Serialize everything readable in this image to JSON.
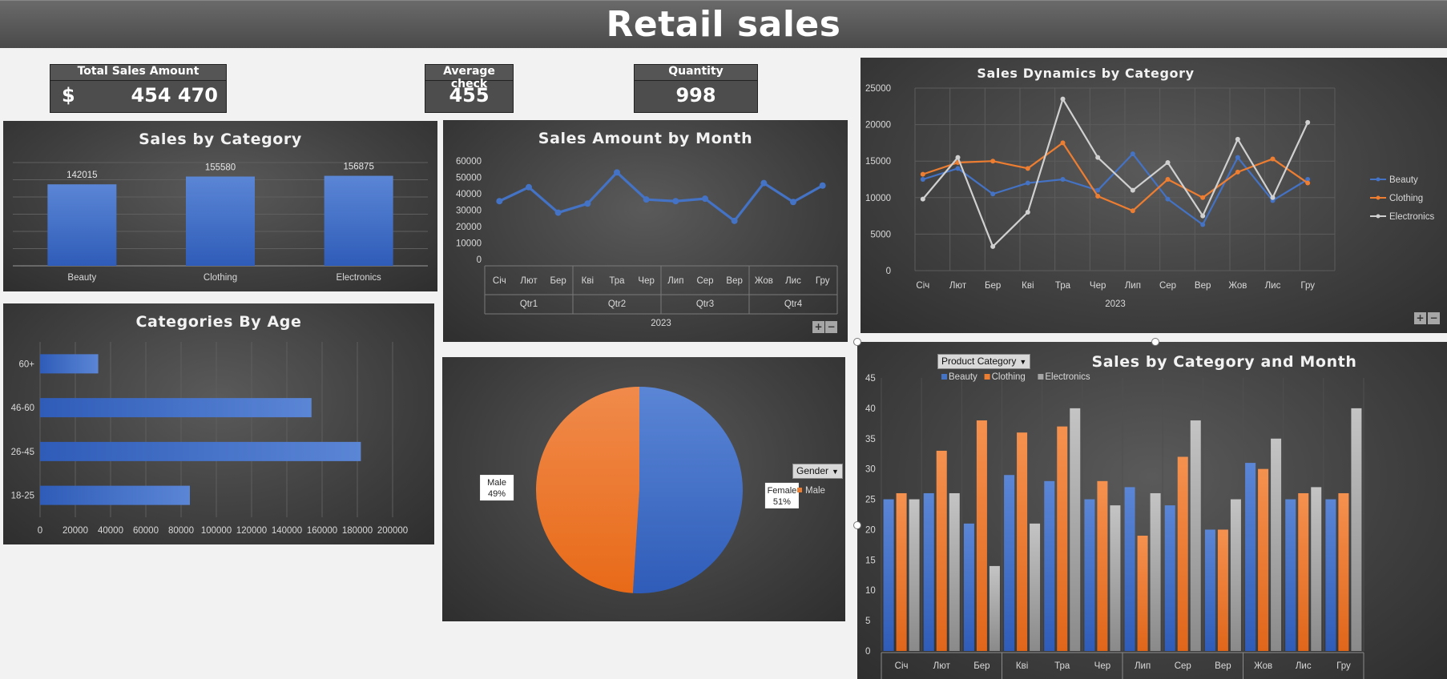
{
  "title": "Retail sales",
  "kpis": {
    "total": {
      "label": "Total Sales Amount",
      "currency": "$",
      "value": "454 470"
    },
    "avg": {
      "label": "Average check",
      "value": "455"
    },
    "qty": {
      "label": "Quantity",
      "value": "998"
    }
  },
  "colors": {
    "blue": "#4472c4",
    "orange": "#ed7d31",
    "gray": "#a5a5a5"
  },
  "chart_data": [
    {
      "id": "cat",
      "type": "bar",
      "title": "Sales by Category",
      "categories": [
        "Beauty",
        "Clothing",
        "Electronics"
      ],
      "values": [
        142015,
        155580,
        156875
      ],
      "ylim": [
        0,
        180000
      ],
      "grid": true
    },
    {
      "id": "month",
      "type": "line",
      "title": "Sales Amount by Month",
      "categories": [
        "Січ",
        "Лют",
        "Бер",
        "Кві",
        "Тра",
        "Чер",
        "Лип",
        "Сер",
        "Вер",
        "Жов",
        "Лис",
        "Гру"
      ],
      "quarters": [
        "Qtr1",
        "Qtr2",
        "Qtr3",
        "Qtr4"
      ],
      "year": "2023",
      "values": [
        35500,
        44000,
        28500,
        34000,
        53000,
        36500,
        35500,
        37000,
        23500,
        46500,
        35000,
        45000
      ],
      "yticks": [
        "0",
        "10000",
        "20000",
        "30000",
        "40000",
        "50000",
        "60000"
      ],
      "ylim": [
        0,
        60000
      ]
    },
    {
      "id": "dyn",
      "type": "line",
      "title": "Sales Dynamics by Category",
      "categories": [
        "Січ",
        "Лют",
        "Бер",
        "Кві",
        "Тра",
        "Чер",
        "Лип",
        "Сер",
        "Вер",
        "Жов",
        "Лис",
        "Гру"
      ],
      "year": "2023",
      "yticks": [
        "0",
        "5000",
        "10000",
        "15000",
        "20000",
        "25000"
      ],
      "ylim": [
        0,
        25000
      ],
      "legend": "right",
      "series": [
        {
          "name": "Beauty",
          "values": [
            12500,
            14000,
            10500,
            12000,
            12500,
            11000,
            16000,
            9800,
            6300,
            15500,
            9600,
            12500
          ]
        },
        {
          "name": "Clothing",
          "values": [
            13200,
            14800,
            15000,
            14000,
            17500,
            10200,
            8200,
            12500,
            10000,
            13500,
            15300,
            12000
          ]
        },
        {
          "name": "Electronics",
          "values": [
            9800,
            15500,
            3300,
            8000,
            23500,
            15500,
            11000,
            14800,
            7500,
            18000,
            10000,
            20300
          ]
        }
      ]
    },
    {
      "id": "age",
      "type": "bar",
      "orientation": "horizontal",
      "title": "Categories By Age",
      "categories": [
        "60+",
        "46-60",
        "26-45",
        "18-25"
      ],
      "values": [
        33000,
        154000,
        182000,
        85000
      ],
      "xticks": [
        "0",
        "20000",
        "40000",
        "60000",
        "80000",
        "100000",
        "120000",
        "140000",
        "160000",
        "180000",
        "200000"
      ],
      "xlim": [
        0,
        210000
      ]
    },
    {
      "id": "gender",
      "type": "pie",
      "filter": "Gender",
      "legend": "right",
      "series": [
        {
          "name": "Female",
          "label": "Female\n51%",
          "value": 51
        },
        {
          "name": "Male",
          "label": "Male\n49%",
          "value": 49
        }
      ]
    },
    {
      "id": "catmonth",
      "type": "bar",
      "title": "Sales by Category and Month",
      "filter": "Product Category",
      "categories": [
        "Січ",
        "Лют",
        "Бер",
        "Кві",
        "Тра",
        "Чер",
        "Лип",
        "Сер",
        "Вер",
        "Жов",
        "Лис",
        "Гру"
      ],
      "yticks": [
        "0",
        "5",
        "10",
        "15",
        "20",
        "25",
        "30",
        "35",
        "40",
        "45"
      ],
      "ylim": [
        0,
        45
      ],
      "legend": "top-left",
      "series": [
        {
          "name": "Beauty",
          "values": [
            25,
            26,
            21,
            29,
            28,
            25,
            27,
            24,
            20,
            31,
            25,
            25
          ]
        },
        {
          "name": "Clothing",
          "values": [
            26,
            33,
            38,
            36,
            37,
            28,
            19,
            32,
            20,
            30,
            26,
            26
          ]
        },
        {
          "name": "Electronics",
          "values": [
            25,
            26,
            14,
            21,
            40,
            24,
            26,
            38,
            25,
            35,
            27,
            40
          ]
        }
      ]
    }
  ]
}
